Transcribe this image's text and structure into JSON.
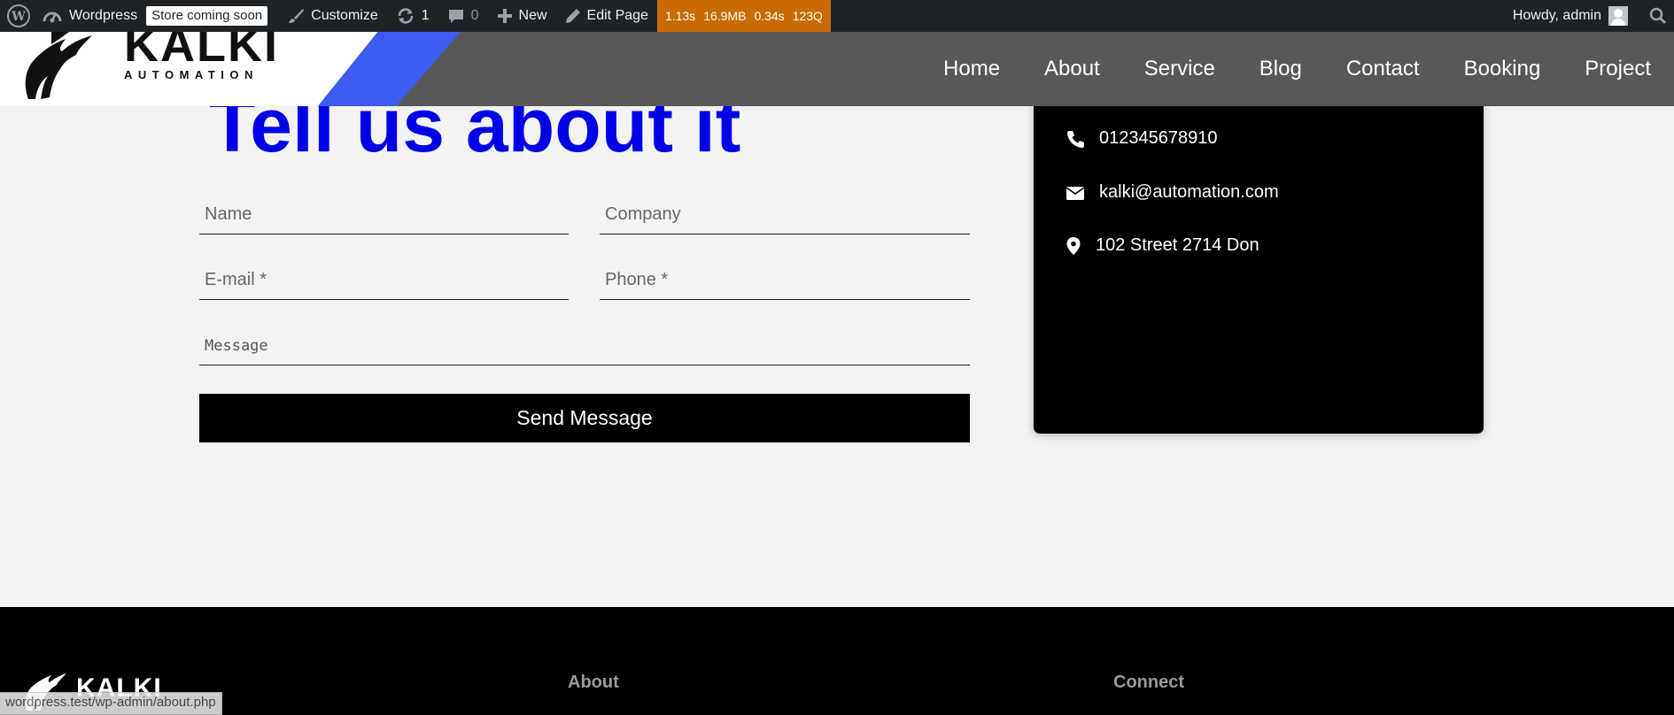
{
  "adminbar": {
    "site_name": "Wordpress",
    "store_badge": "Store coming soon",
    "customize": "Customize",
    "updates_count": "1",
    "comments_count": "0",
    "new": "New",
    "edit_page": "Edit Page",
    "qm_time": "1.13s",
    "qm_memory": "16.9MB",
    "qm_db_time": "0.34s",
    "qm_queries": "123Q",
    "greeting": "Howdy, admin"
  },
  "header": {
    "logo_word": "KALKI",
    "logo_sub": "AUTOMATION",
    "nav": [
      "Home",
      "About",
      "Service",
      "Blog",
      "Contact",
      "Booking",
      "Project"
    ]
  },
  "form": {
    "heading": "Tell us about it",
    "name_placeholder": "Name",
    "company_placeholder": "Company",
    "email_placeholder": "E-mail *",
    "phone_placeholder": "Phone *",
    "message_placeholder": "Message",
    "send_label": "Send Message"
  },
  "contact": {
    "phone": "012345678910",
    "email": "kalki@automation.com",
    "address": "102 Street 2714 Don"
  },
  "footer": {
    "logo_word": "KALKI",
    "col_about": "About",
    "col_connect": "Connect"
  },
  "status_url": "wordpress.test/wp-admin/about.php",
  "colors": {
    "heading_blue": "#0000e6",
    "logo_stripe": "#3d5af1",
    "query_monitor": "#c86b00",
    "adminbar_bg": "#1d2327"
  }
}
